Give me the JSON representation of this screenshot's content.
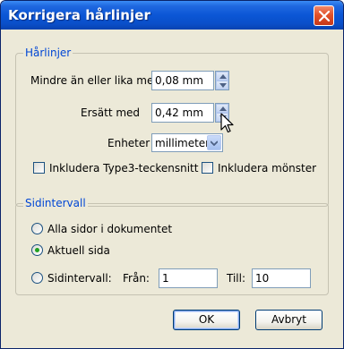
{
  "window": {
    "title": "Korrigera hårlinjer",
    "close_icon": "close-icon"
  },
  "hairlines": {
    "legend": "Hårlinjer",
    "less_or_equal_label": "Mindre än eller lika med",
    "less_or_equal_value": "0,08 mm",
    "replace_label": "Ersätt med",
    "replace_value": "0,42 mm",
    "units_label": "Enheter",
    "units_value": "millimeter",
    "include_type3_label": "Inkludera Type3-teckensnitt",
    "include_type3_checked": false,
    "include_patterns_label": "Inkludera mönster",
    "include_patterns_checked": false
  },
  "page_range": {
    "legend": "Sidintervall",
    "all_pages_label": "Alla sidor i dokumentet",
    "current_page_label": "Aktuell sida",
    "page_range_label": "Sidintervall:",
    "from_label": "Från:",
    "from_value": "1",
    "to_label": "Till:",
    "to_value": "10",
    "selected": "current_page"
  },
  "buttons": {
    "ok_label": "OK",
    "cancel_label": "Avbryt"
  },
  "colors": {
    "title_bar": "#0b56d6",
    "group_legend": "#0046d5",
    "radio_dot": "#21a121"
  }
}
